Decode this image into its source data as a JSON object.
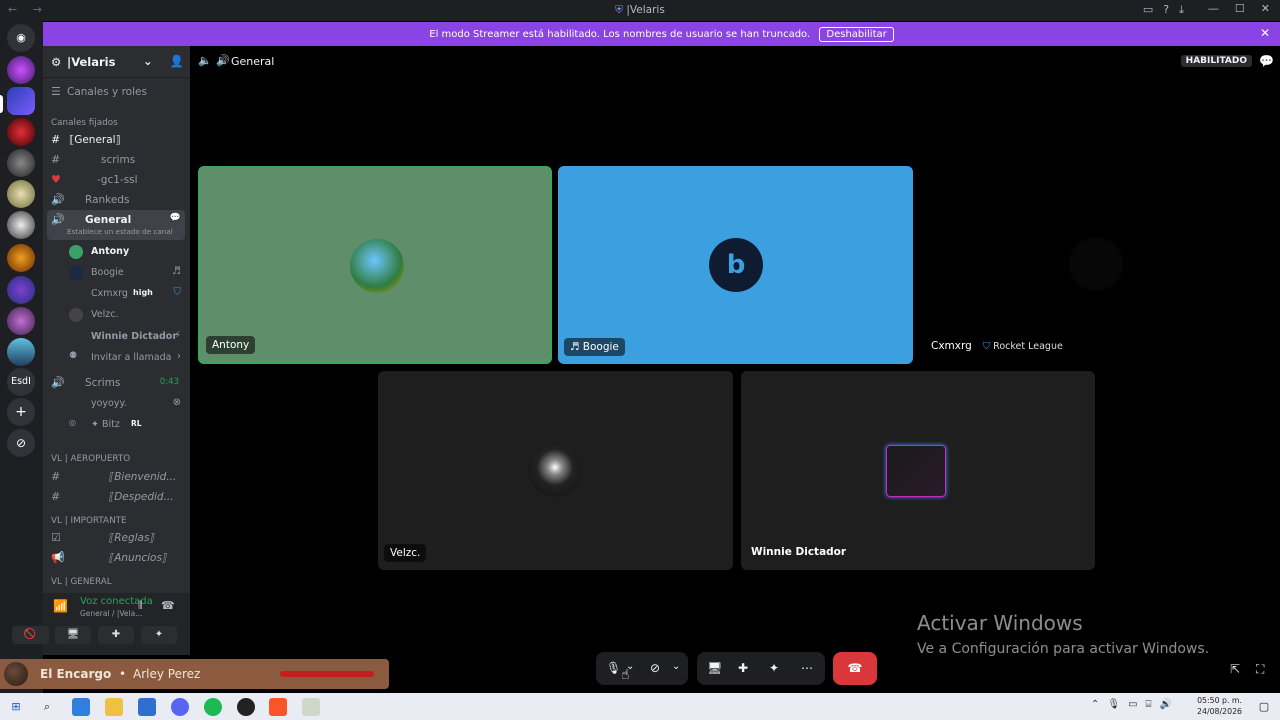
{
  "window": {
    "title": "|Velaris",
    "title_icon": "discord-shield-icon"
  },
  "banner": {
    "text": "El modo Streamer está habilitado. Los nombres de usuario se han truncado.",
    "button": "Deshabilitar"
  },
  "server": {
    "name": "|Velaris",
    "roles_link": "Canales y roles",
    "pinned_header": "Canales fijados",
    "pinned": [
      {
        "label": "⟦General⟧"
      },
      {
        "label": "scrims"
      },
      {
        "label": "-gc1-ssl"
      },
      {
        "label": "Rankeds"
      },
      {
        "label": "General",
        "status": "Establece un estado de canal"
      }
    ],
    "voice_users": [
      {
        "name": "Antony"
      },
      {
        "name": "Boogie"
      },
      {
        "name": "Cxmxrg",
        "tag": "high"
      },
      {
        "name": "Velzc."
      },
      {
        "name": "Winnie Dictador"
      }
    ],
    "invite": "Invitar a llamada",
    "scrims_channel": {
      "label": "Scrims",
      "time": "0:43"
    },
    "scrims_users": [
      {
        "name": "yoyoyy."
      },
      {
        "name": "✦ Bitz",
        "tag": "RL"
      }
    ],
    "categories": [
      {
        "name": "VL | AEROPUERTO",
        "channels": [
          "⟦Bienvenid...",
          "⟦Despedid..."
        ]
      },
      {
        "name": "VL | IMPORTANTE",
        "channels": [
          "⟦Reglas⟧",
          "⟦Anuncios⟧"
        ]
      },
      {
        "name": "VL | GENERAL",
        "channels": []
      }
    ]
  },
  "voice_panel": {
    "status": "Voz conectada",
    "channel": "General / |Vela..."
  },
  "activity": {
    "title": "El Encargo",
    "artist": "Arley Perez",
    "separator": "•"
  },
  "stage": {
    "channel": "General",
    "badge": "HABILITADO"
  },
  "tiles": [
    {
      "name": "Antony",
      "bg": "#5f8f6a"
    },
    {
      "name": "Boogie",
      "bg": "#3c9fe0"
    },
    {
      "name": "Cxmxrg",
      "game": "Rocket League",
      "bg": "#000000"
    },
    {
      "name": "Velzc.",
      "bg": "#1e1e1e"
    },
    {
      "name": "Winnie Dictador",
      "bg": "#1e1e1e"
    }
  ],
  "activate_windows": {
    "line1": "Activar Windows",
    "line2": "Ve a Configuración para activar Windows."
  },
  "clock": {
    "time": "05:50 p. m.",
    "date": "24/08/2026"
  },
  "colors": {
    "accent": "#8a44e4",
    "voice_green": "#23a55a",
    "end_call": "#da373c",
    "tile_green": "#5f8f6a",
    "tile_blue": "#3c9fe0"
  }
}
